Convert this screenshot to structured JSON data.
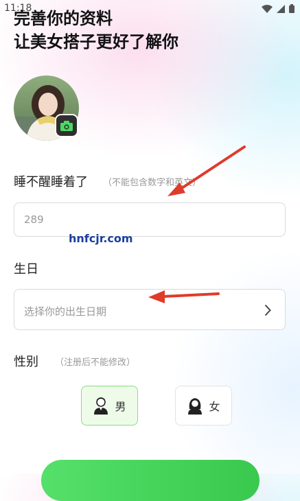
{
  "status_bar": {
    "time": "11:18"
  },
  "header": {
    "title": "完善你的资料",
    "subtitle": "让美女搭子更好了解你"
  },
  "avatar": {
    "icon": "camera-icon"
  },
  "nickname": {
    "label": "睡不醒睡着了",
    "hint": "（不能包含数字和英文）",
    "value": "289"
  },
  "birthday": {
    "label": "生日",
    "placeholder": "选择你的出生日期"
  },
  "gender": {
    "label": "性别",
    "hint": "（注册后不能修改）",
    "options": [
      {
        "label": "男",
        "icon": "male-avatar-icon",
        "selected": true
      },
      {
        "label": "女",
        "icon": "female-avatar-icon",
        "selected": false
      }
    ]
  },
  "watermark": "hnfcjr.com",
  "colors": {
    "accent_green": "#55e06a",
    "selected_bg": "#effbe9",
    "arrow_red": "#e03b2a"
  }
}
